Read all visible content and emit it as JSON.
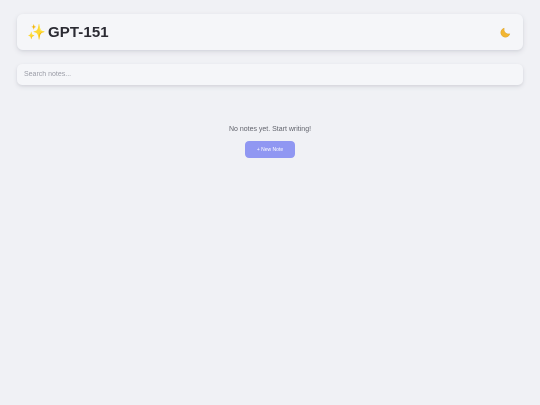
{
  "header": {
    "icon": "sparkles-icon",
    "title": "GPT-151",
    "theme_toggle_icon": "crescent-moon-icon"
  },
  "search": {
    "placeholder": "Search notes...",
    "value": ""
  },
  "empty_state": {
    "message": "No notes yet. Start writing!",
    "button_label": "+ New Note"
  },
  "colors": {
    "background": "#f0f1f5",
    "surface": "#f5f6f9",
    "accent": "#9097f2",
    "sparkle": "#f4b400",
    "moon": "#f2b632"
  }
}
